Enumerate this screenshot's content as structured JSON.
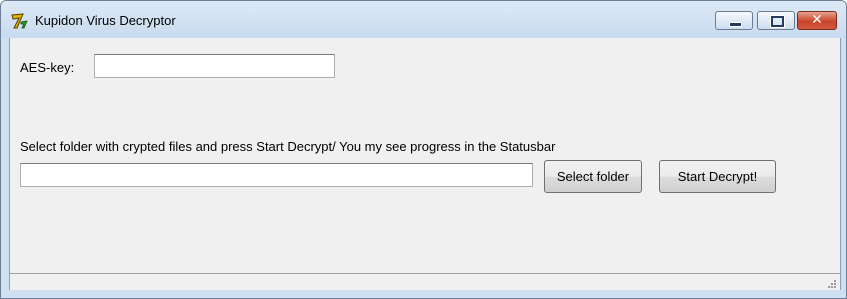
{
  "window": {
    "title": "Kupidon Virus Decryptor",
    "icon": "app-icon",
    "controls": [
      "minimize-icon",
      "maximize-icon",
      "close-icon"
    ],
    "close_glyph": "✕"
  },
  "form": {
    "aes_label": "AES-key:",
    "aes_value": "",
    "instruction": "Select folder with crypted files and press Start Decrypt/ You my see progress in the Statusbar",
    "folder_value": "",
    "select_folder_label": "Select folder",
    "start_decrypt_label": "Start Decrypt!"
  },
  "statusbar": {
    "text": ""
  }
}
